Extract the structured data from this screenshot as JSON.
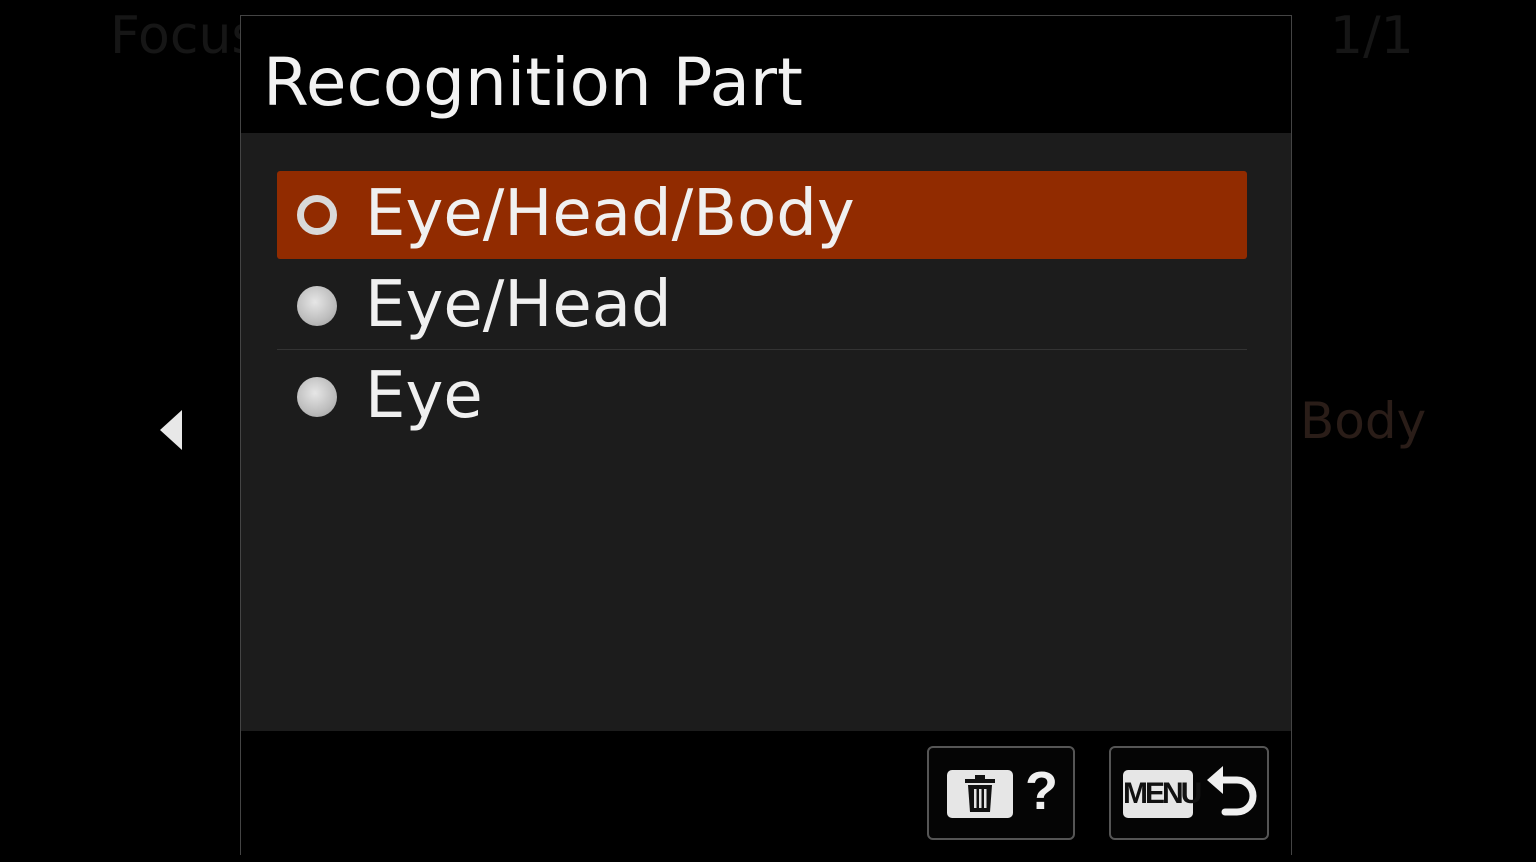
{
  "background": {
    "menu_title": "Focus",
    "page_indicator": "1/1",
    "current_value": "Body"
  },
  "dialog": {
    "title": "Recognition Part",
    "options": [
      {
        "label": "Eye/Head/Body",
        "selected": true
      },
      {
        "label": "Eye/Head",
        "selected": false
      },
      {
        "label": "Eye",
        "selected": false
      }
    ]
  },
  "footer": {
    "help_icon": "trash-icon",
    "help_symbol": "?",
    "menu_label": "MENU",
    "return_icon": "return-icon"
  },
  "colors": {
    "selection": "#912b00",
    "body_bg": "#1c1c1c"
  }
}
